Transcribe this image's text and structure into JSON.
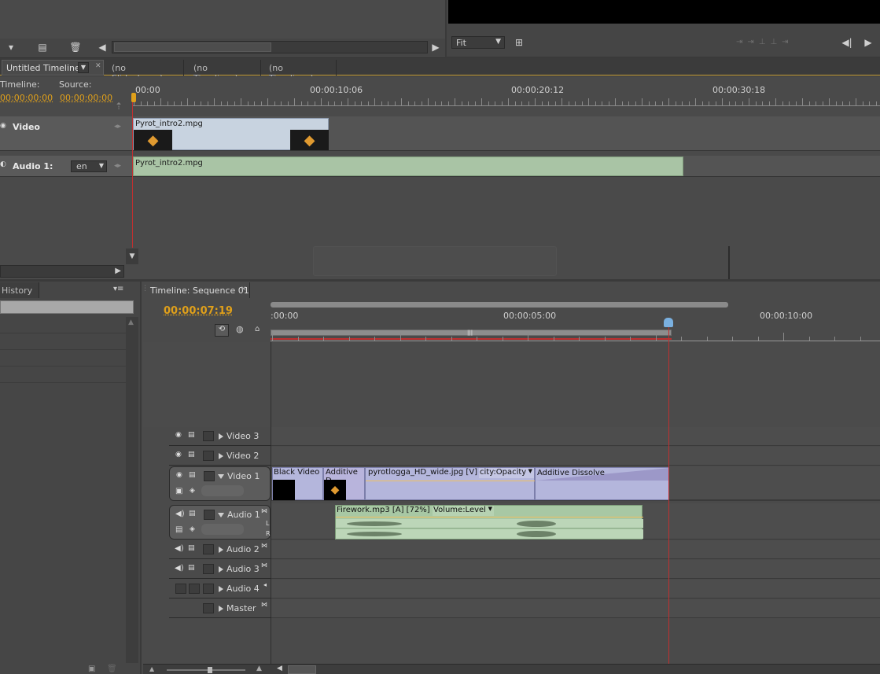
{
  "top_tabs": {
    "active": "Untitled Timeline",
    "others": [
      "(no Slideshows)",
      "(no Timelines)",
      "(no Timelines)"
    ]
  },
  "monitor": {
    "fit_label": "Fit"
  },
  "timeline_top": {
    "timeline_label": "Timeline:",
    "source_label": "Source:",
    "timeline_tc": "00:00:00:00",
    "source_tc": "00:00:00:00",
    "ruler_labels": [
      "00:00",
      "00:00:10:06",
      "00:00:20:12",
      "00:00:30:18"
    ],
    "video_track": "Video",
    "audio_track": "Audio 1:",
    "lang": "en",
    "video_clip": "Pyrot_intro2.mpg",
    "audio_clip": "Pyrot_intro2.mpg"
  },
  "history_tab": "History",
  "sequence": {
    "tab_title": "Timeline: Sequence 01",
    "timecode": "00:00:07:19",
    "ruler_labels": [
      ":00:00",
      "00:00:05:00",
      "00:00:10:00"
    ],
    "tracks": {
      "video3": "Video 3",
      "video2": "Video 2",
      "video1": "Video 1",
      "audio1": "Audio 1",
      "audio2": "Audio 2",
      "audio3": "Audio 3",
      "audio4": "Audio 4",
      "master": "Master"
    },
    "channel_l": "L",
    "channel_r": "R",
    "clips": {
      "black_video": "Black Video",
      "additive_short": "Additive D",
      "pyro_jpg": "pyrotlogga_HD_wide.jpg [V]",
      "opacity": "city:Opacity",
      "additive_dissolve": "Additive Dissolve",
      "firework": "Firework.mp3 [A] [72%]",
      "volume": "Volume:Level"
    }
  },
  "colors": {
    "accent_timecode": "#e0a01a",
    "video_clip": "#b4b6dc",
    "audio_clip": "#a8c8a4",
    "playhead": "#c03030"
  }
}
